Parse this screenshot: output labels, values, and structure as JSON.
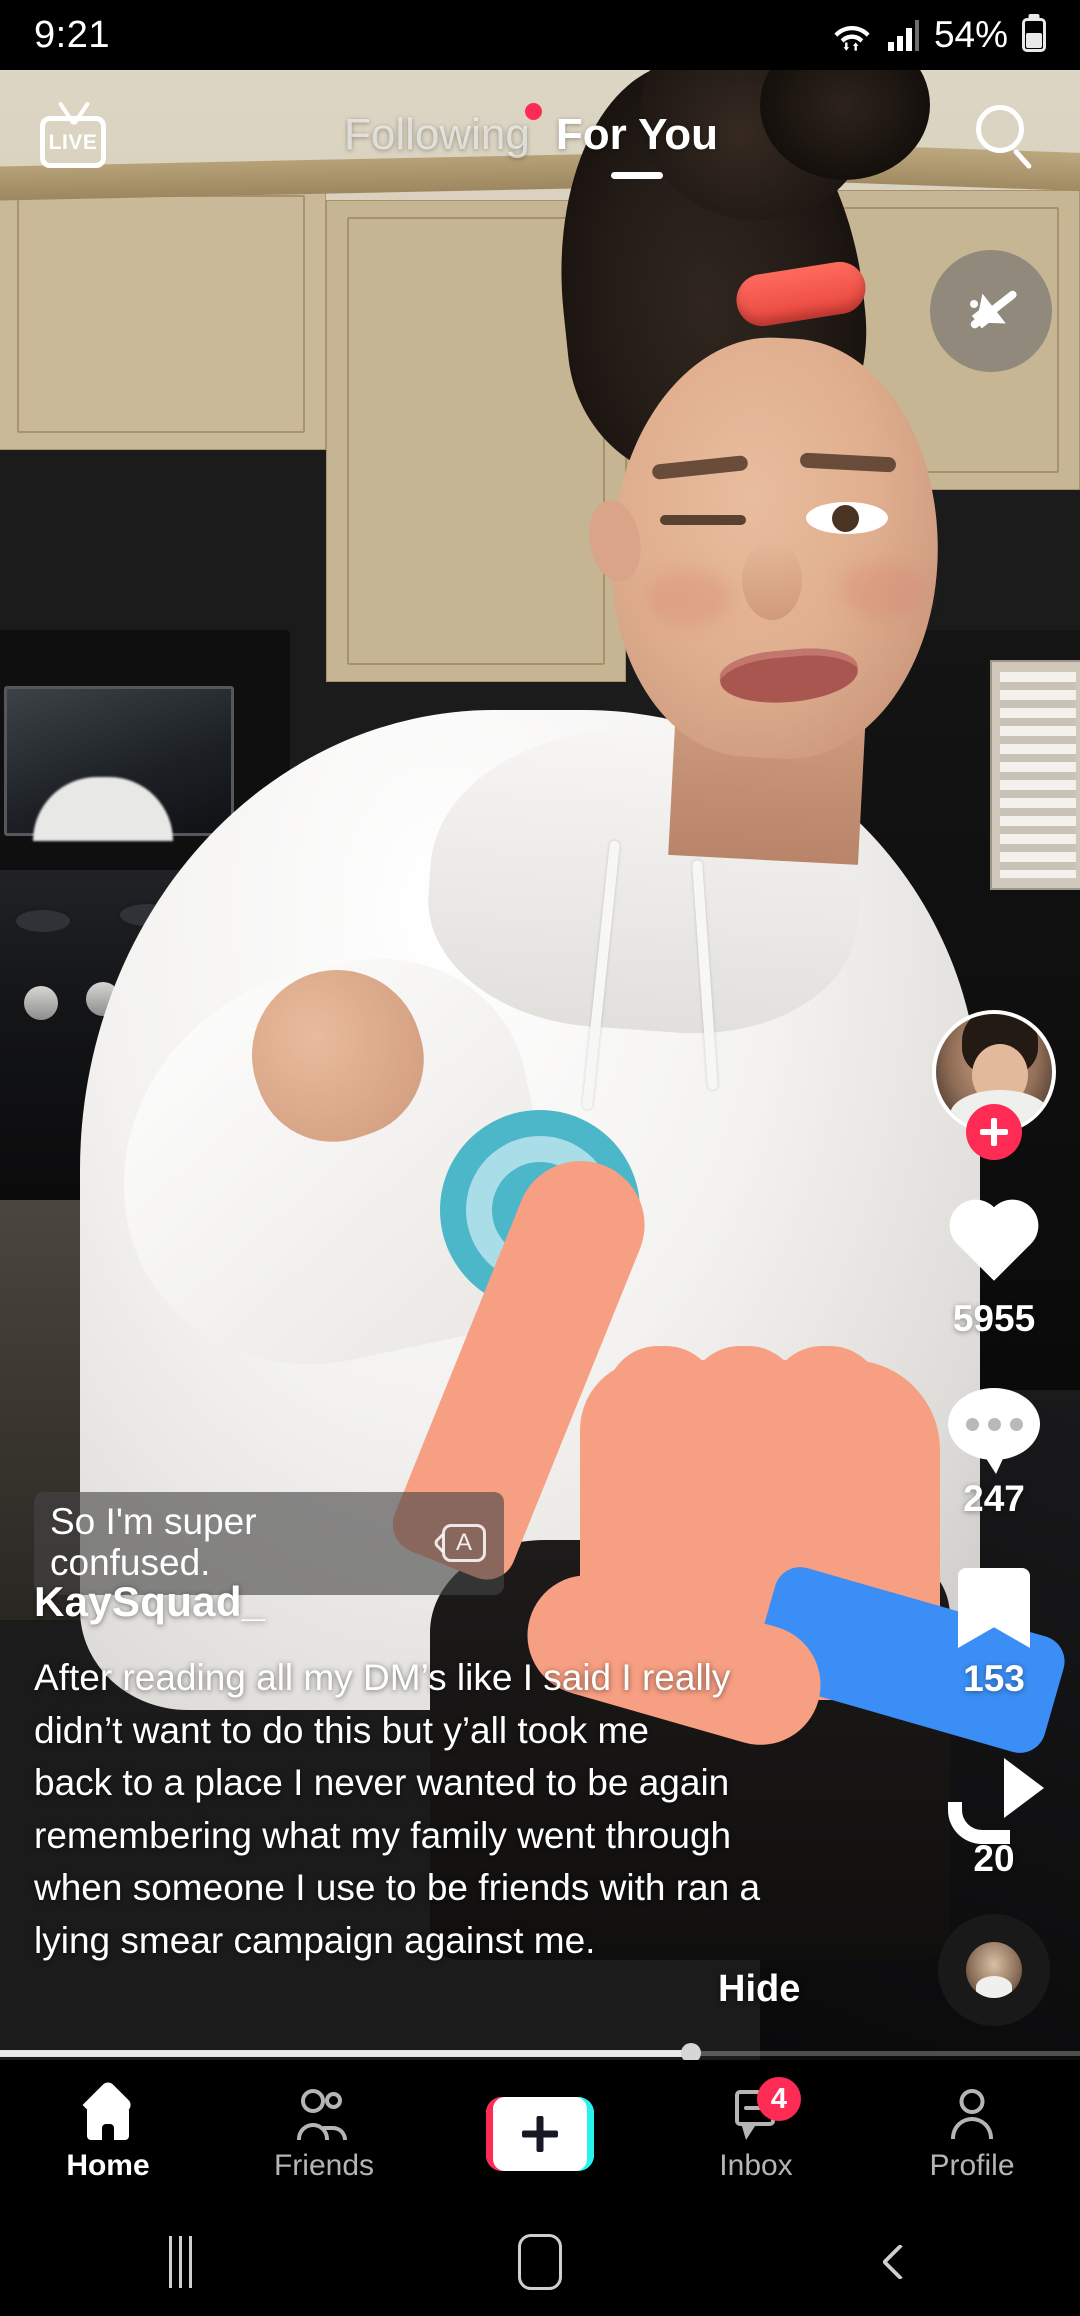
{
  "status_bar": {
    "time": "9:21",
    "battery_percent": "54%",
    "icons": [
      "wifi-icon",
      "cellular-signal-icon",
      "battery-icon"
    ]
  },
  "top_nav": {
    "live_label": "LIVE",
    "tabs": [
      {
        "label": "Following",
        "active": false,
        "has_dot": true
      },
      {
        "label": "For You",
        "active": true,
        "has_dot": false
      }
    ],
    "search_icon": "search-icon"
  },
  "video": {
    "mute_icon": "speaker-muted-icon",
    "subtitle": "So I'm super confused.",
    "caption_icon": "auto-caption-icon",
    "username": "KaySquad_",
    "description": "After reading all my DM’s like I said I really\ndidn’t want to do this but y’all took me\nback to a place I never wanted to be again\nremembering what my family went through\nwhen someone I use to be friends with ran a\nlying smear campaign against me.",
    "hide_label": "Hide",
    "progress_percent": 64
  },
  "action_rail": {
    "follow_icon": "plus-icon",
    "items": [
      {
        "icon": "heart-icon",
        "count": "5955"
      },
      {
        "icon": "comment-icon",
        "count": "247"
      },
      {
        "icon": "bookmark-icon",
        "count": "153"
      },
      {
        "icon": "share-icon",
        "count": "20"
      }
    ],
    "music_disc_icon": "music-disc-icon"
  },
  "bottom_nav": {
    "items": [
      {
        "label": "Home",
        "icon": "home-icon",
        "active": true,
        "badge": ""
      },
      {
        "label": "Friends",
        "icon": "friends-icon",
        "active": false,
        "badge": ""
      },
      {
        "label": "",
        "icon": "create-icon",
        "active": false,
        "badge": ""
      },
      {
        "label": "Inbox",
        "icon": "inbox-icon",
        "active": false,
        "badge": "4"
      },
      {
        "label": "Profile",
        "icon": "profile-icon",
        "active": false,
        "badge": ""
      }
    ]
  },
  "system_nav": {
    "items": [
      "recents-icon",
      "home-icon",
      "back-icon"
    ]
  },
  "colors": {
    "accent_red": "#fe2c55",
    "accent_cyan": "#25f4ee",
    "background": "#000000"
  }
}
